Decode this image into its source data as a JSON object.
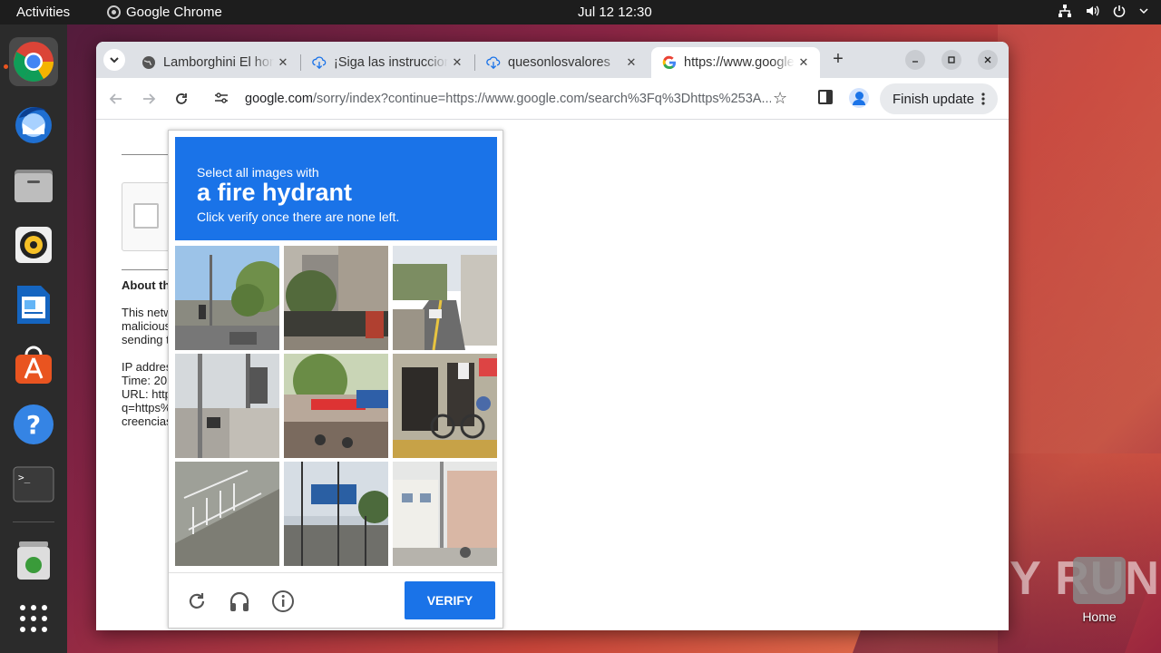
{
  "topbar": {
    "activities": "Activities",
    "app_name": "Google Chrome",
    "clock": "Jul 12  12:30"
  },
  "dock": {
    "items": [
      {
        "name": "chrome"
      },
      {
        "name": "thunderbird"
      },
      {
        "name": "files"
      },
      {
        "name": "rhythmbox"
      },
      {
        "name": "libreoffice-writer"
      },
      {
        "name": "app-center"
      },
      {
        "name": "help"
      },
      {
        "name": "terminal"
      },
      {
        "name": "trash"
      },
      {
        "name": "show-apps"
      }
    ]
  },
  "desktop": {
    "home_label": "Home",
    "watermark": "ANY RUN"
  },
  "browser": {
    "tabs": [
      {
        "title": "Lamborghini El hombre",
        "icon": "globe-icon",
        "active": false
      },
      {
        "title": "¡Siga las instrucciones",
        "icon": "download-cloud-icon",
        "active": false
      },
      {
        "title": "quesonlosvalores",
        "icon": "download-cloud-icon",
        "active": false
      },
      {
        "title": "https://www.google.com",
        "icon": "google-icon",
        "active": true
      }
    ],
    "url_host": "google.com",
    "url_rest": "/sorry/index?continue=https://www.google.com/search%3Fq%3Dhttps%253A...",
    "finish_update": "Finish update"
  },
  "page": {
    "about_heading": "About th",
    "para": [
      "This netw",
      "malicious",
      "sending t"
    ],
    "ip_lines": [
      "IP addres",
      "Time: 20",
      "URL: http",
      "q=https%",
      "creencias"
    ]
  },
  "captcha": {
    "line1": "Select all images with",
    "target": "a fire hydrant",
    "line3": "Click verify once there are none left.",
    "verify_label": "VERIFY",
    "colors": {
      "header": "#1a73e8",
      "button": "#1a73e8"
    },
    "tiles": [
      "street-trees-sky",
      "buildings-trees",
      "road-street",
      "traffic-light-pole",
      "shop-front",
      "bicycle-shop",
      "railing-closeup",
      "blue-sign-train",
      "white-buildings"
    ]
  }
}
